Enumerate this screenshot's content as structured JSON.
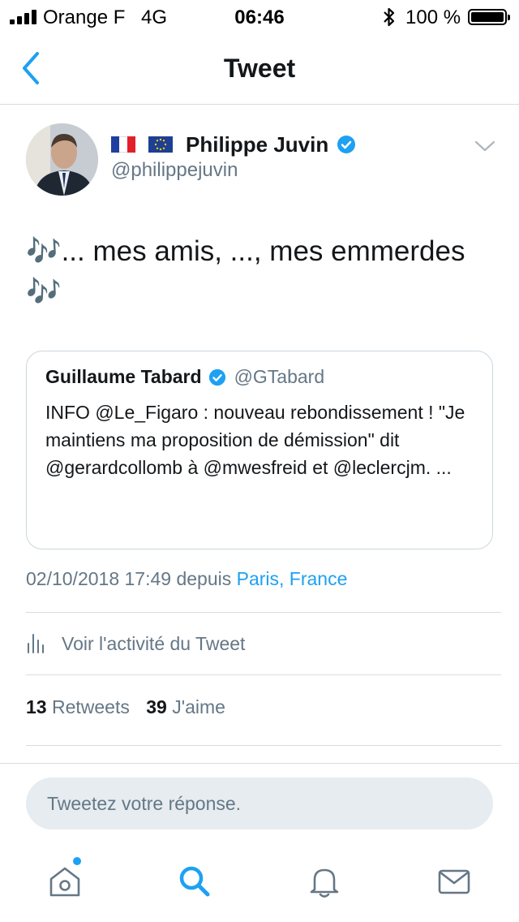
{
  "status_bar": {
    "carrier": "Orange F",
    "network": "4G",
    "time": "06:46",
    "battery_percent": "100 %",
    "battery_level": 1.0,
    "signal_bars": 4
  },
  "nav": {
    "title": "Tweet",
    "back_icon": "chevron-left-icon"
  },
  "tweet": {
    "author_flags": [
      "france-flag-icon",
      "eu-flag-icon"
    ],
    "author_name": "Philippe Juvin",
    "verified": true,
    "author_handle": "@philippejuvin",
    "text": "🎶... mes amis, ..., mes emmerdes 🎶",
    "quoted": {
      "author_name": "Guillaume Tabard",
      "verified": true,
      "author_handle": "@GTabard",
      "text": "INFO @Le_Figaro : nouveau rebondissement ! \"Je maintiens ma proposition de démission\" dit @gerardcollomb à @mwesfreid et @leclercjm. ..."
    },
    "timestamp": "02/10/2018 17:49 depuis",
    "location": "Paris, France",
    "activity_label": "Voir l'activité du Tweet",
    "retweets_count": "13",
    "retweets_label": "Retweets",
    "likes_count": "39",
    "likes_label": "J'aime"
  },
  "reply": {
    "placeholder": "Tweetez votre réponse."
  },
  "tab_bar": {
    "items": [
      "home-icon",
      "search-icon",
      "notifications-icon",
      "messages-icon"
    ],
    "active": "search-icon",
    "home_has_badge": true
  },
  "colors": {
    "accent": "#1da1f2",
    "text_primary": "#14171a",
    "text_secondary": "#657786",
    "divider": "#d8dde1",
    "input_bg": "#e6ecf0",
    "tab_inactive": "#657786"
  }
}
